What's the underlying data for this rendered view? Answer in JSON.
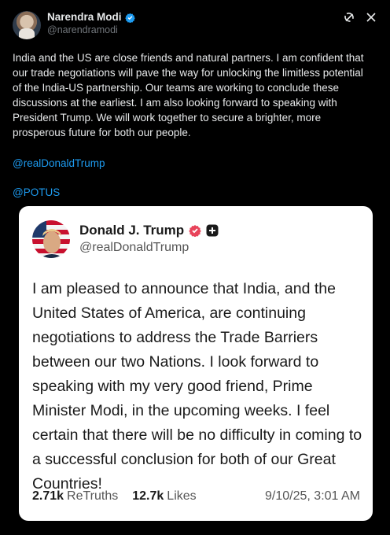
{
  "post": {
    "author_name": "Narendra Modi",
    "handle": "@narendramodi",
    "body": "India and the US are close friends and natural partners. I am confident that our trade negotiations will pave the way for unlocking the limitless potential of the India-US partnership. Our teams are working to conclude these discussions at the earliest. I am also looking forward to speaking with President Trump. We will work together to secure a brighter, more prosperous future for both our people.",
    "mentions": [
      "@realDonaldTrump",
      "@POTUS"
    ],
    "icons": {
      "verified": "verified-badge-icon",
      "grok": "grok-icon",
      "close": "close-icon"
    },
    "colors": {
      "background": "#000000",
      "link": "#1d9bf0",
      "verified": "#1d9bf0"
    }
  },
  "card": {
    "author_name": "Donald J. Trump",
    "handle": "@realDonaldTrump",
    "text": "I am pleased to announce that India, and the United States of America, are continuing negotiations to address the Trade Barriers between our two Nations. I look forward to speaking with my very good friend, Prime Minister Modi, in the upcoming weeks. I feel certain that there will be no difficulty in coming to a successful conclusion for both of our Great Countries!",
    "retruths_count": "2.71k",
    "retruths_label": "ReTruths",
    "likes_count": "12.7k",
    "likes_label": "Likes",
    "timestamp": "9/10/25, 3:01 AM",
    "icons": {
      "verified": "verified-check-icon",
      "plus": "plus-badge-icon"
    },
    "colors": {
      "background": "#ffffff",
      "verified": "#e8435a"
    }
  }
}
